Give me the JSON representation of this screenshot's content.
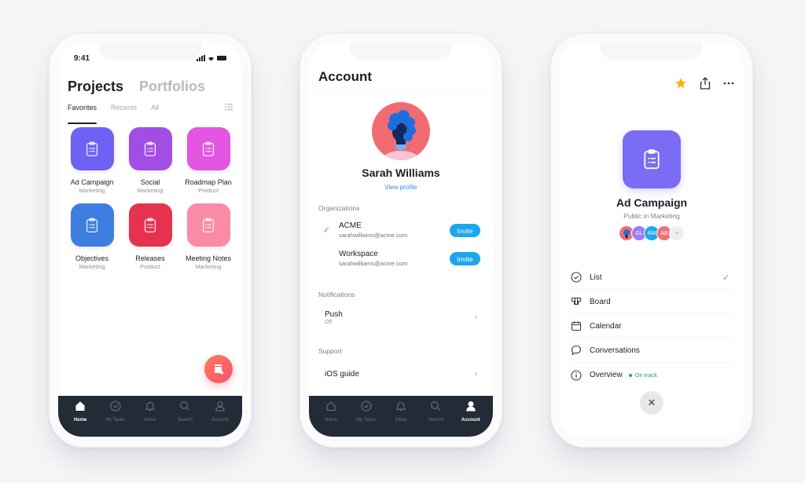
{
  "colors": {
    "background": "#f4f5f7",
    "tabbar": "#232b36",
    "invite": "#1ba7ee",
    "success": "#2fbf8a",
    "link": "#2f8de4",
    "star": "#f7b500"
  },
  "phone1": {
    "status_bar": {
      "time": "9:41"
    },
    "header": {
      "active_title": "Projects",
      "inactive_title": "Portfolios"
    },
    "subtabs": [
      {
        "label": "Favorites",
        "active": true
      },
      {
        "label": "Recents",
        "active": false
      },
      {
        "label": "All",
        "active": false
      }
    ],
    "projects": [
      {
        "name": "Ad Campaign",
        "team": "Marketing",
        "color": "#6e62f5",
        "icon": "clipboard-icon"
      },
      {
        "name": "Social",
        "team": "Marketing",
        "color": "#a24ee6",
        "icon": "clipboard-icon"
      },
      {
        "name": "Roadmap Plan",
        "team": "Product",
        "color": "#e356e2",
        "icon": "clipboard-icon"
      },
      {
        "name": "Objectives",
        "team": "Marketing",
        "color": "#3d7fe0",
        "icon": "clipboard-icon"
      },
      {
        "name": "Releases",
        "team": "Product",
        "color": "#e5334f",
        "icon": "clipboard-icon"
      },
      {
        "name": "Meeting Notes",
        "team": "Marketing",
        "color": "#f98ba6",
        "icon": "clipboard-icon"
      }
    ],
    "tabbar": [
      {
        "label": "Home",
        "icon": "home-icon",
        "active": true
      },
      {
        "label": "My Tasks",
        "icon": "check-circle-icon",
        "active": false
      },
      {
        "label": "Inbox",
        "icon": "bell-icon",
        "active": false
      },
      {
        "label": "Search",
        "icon": "search-icon",
        "active": false
      },
      {
        "label": "Account",
        "icon": "person-icon",
        "active": false
      }
    ]
  },
  "phone2": {
    "title": "Account",
    "user": {
      "name": "Sarah Williams",
      "view_profile": "View profile"
    },
    "organizations_label": "Organizations",
    "organizations": [
      {
        "name": "ACME",
        "email": "sarahwilliams@acme.com",
        "selected": true,
        "action": "Invite"
      },
      {
        "name": "Workspace",
        "email": "sarahwilliams@acme.com",
        "selected": false,
        "action": "Invite"
      }
    ],
    "notifications_label": "Notifications",
    "notifications": {
      "title": "Push",
      "value": "Off"
    },
    "support_label": "Support",
    "support": {
      "title": "iOS guide"
    },
    "tabbar": [
      {
        "label": "Home",
        "icon": "home-icon",
        "active": false
      },
      {
        "label": "My Tasks",
        "icon": "check-circle-icon",
        "active": false
      },
      {
        "label": "Inbox",
        "icon": "bell-icon",
        "active": false
      },
      {
        "label": "Search",
        "icon": "search-icon",
        "active": false
      },
      {
        "label": "Account",
        "icon": "person-icon",
        "active": true
      }
    ]
  },
  "phone3": {
    "project": {
      "name": "Ad Campaign",
      "subtitle": "Public in Marketing"
    },
    "members": [
      {
        "initials": "",
        "color": "#f26b72",
        "type": "photo"
      },
      {
        "initials": "GL",
        "color": "#9b7cf2"
      },
      {
        "initials": "AW",
        "color": "#1ba7ee"
      },
      {
        "initials": "AB",
        "color": "#f2707a"
      },
      {
        "initials": "+",
        "color": "#eceef0"
      }
    ],
    "views": [
      {
        "label": "List",
        "icon": "check-circle-icon",
        "selected": true
      },
      {
        "label": "Board",
        "icon": "board-icon",
        "selected": false
      },
      {
        "label": "Calendar",
        "icon": "calendar-icon",
        "selected": false
      },
      {
        "label": "Conversations",
        "icon": "chat-bubble-icon",
        "selected": false
      },
      {
        "label": "Overview",
        "icon": "info-icon",
        "selected": false,
        "status": "On track"
      }
    ],
    "close_label": "✕"
  }
}
